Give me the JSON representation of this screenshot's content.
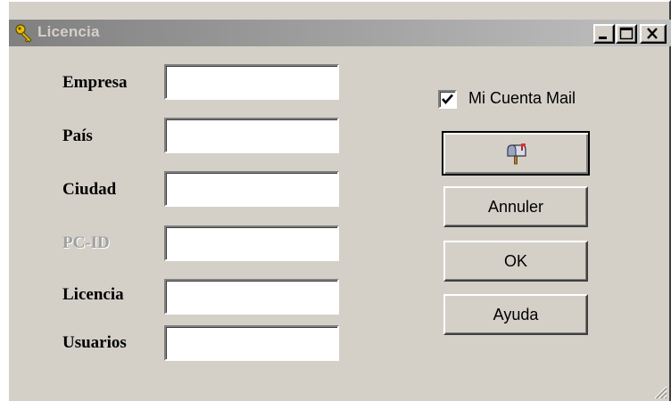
{
  "window": {
    "title": "Licencia",
    "icon": "key-icon",
    "controls": {
      "minimize": "minimize-icon",
      "maximize": "maximize-icon",
      "close": "close-icon"
    }
  },
  "form": {
    "fields": [
      {
        "label": "Empresa",
        "value": "",
        "enabled": true
      },
      {
        "label": "País",
        "value": "",
        "enabled": true
      },
      {
        "label": "Ciudad",
        "value": "",
        "enabled": true
      },
      {
        "label": "PC-ID",
        "value": "",
        "enabled": false
      },
      {
        "label": "Licencia",
        "value": "",
        "enabled": true
      },
      {
        "label": "Usuarios",
        "value": "",
        "enabled": true
      }
    ]
  },
  "options": {
    "mail_account": {
      "label": "Mi Cuenta Mail",
      "checked": true
    }
  },
  "buttons": {
    "mail": {
      "icon": "mailbox-icon"
    },
    "cancel": "Annuler",
    "ok": "OK",
    "help": "Ayuda"
  },
  "colors": {
    "face": "#d4d0c8",
    "title_gradient_start": "#808080",
    "title_gradient_end": "#c0c0c0",
    "disabled_text": "#a0a0a0"
  }
}
